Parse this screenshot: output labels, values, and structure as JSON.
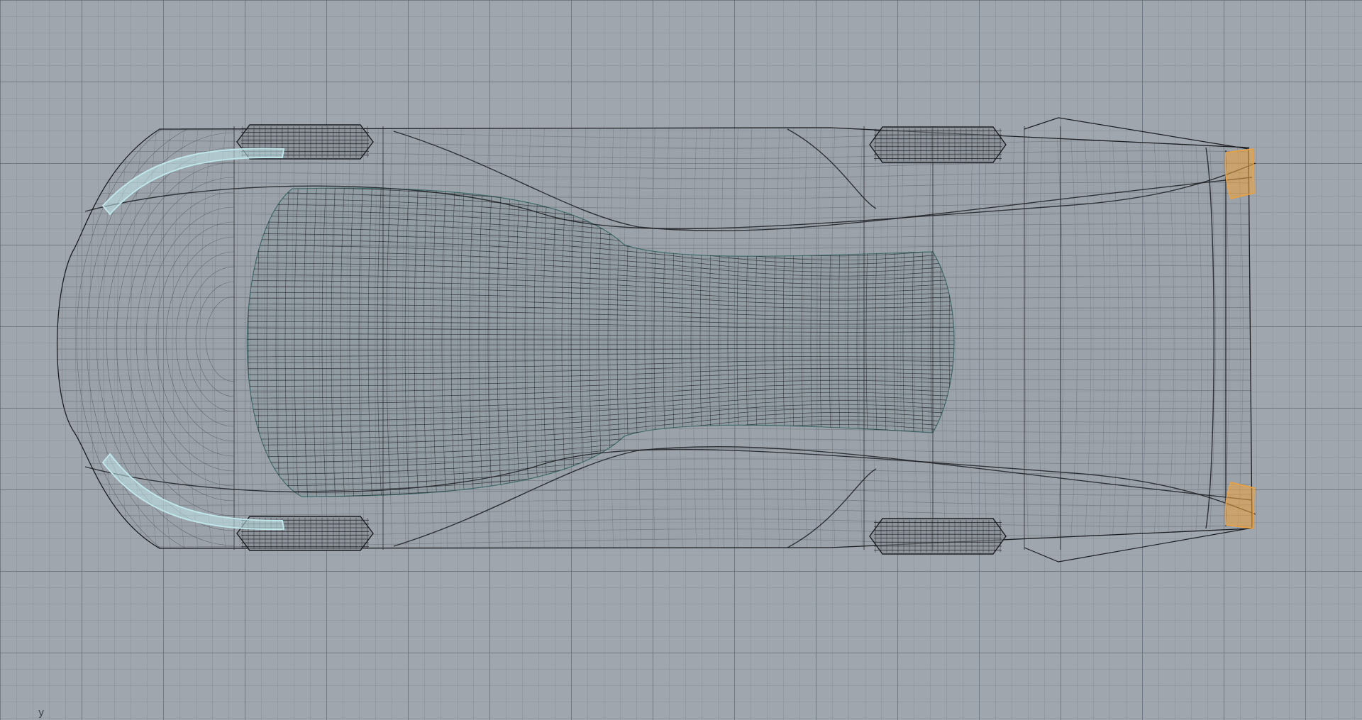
{
  "viewport": {
    "view": "Top",
    "axis_label": "y",
    "colors": {
      "background": "#9fa6ae",
      "grid_major": "#58606a",
      "grid_minor": "#78808a",
      "wire": "#4e5258",
      "wire_dark": "#1c1e22",
      "wire_light": "#6e7379",
      "selection_cyan": "#bfe6ea",
      "selection_orange": "#f0a23a",
      "panel_teal": "#3f6b6b"
    }
  },
  "model": {
    "name": "car-body-wireframe",
    "icon": "car-wireframe-icon"
  }
}
